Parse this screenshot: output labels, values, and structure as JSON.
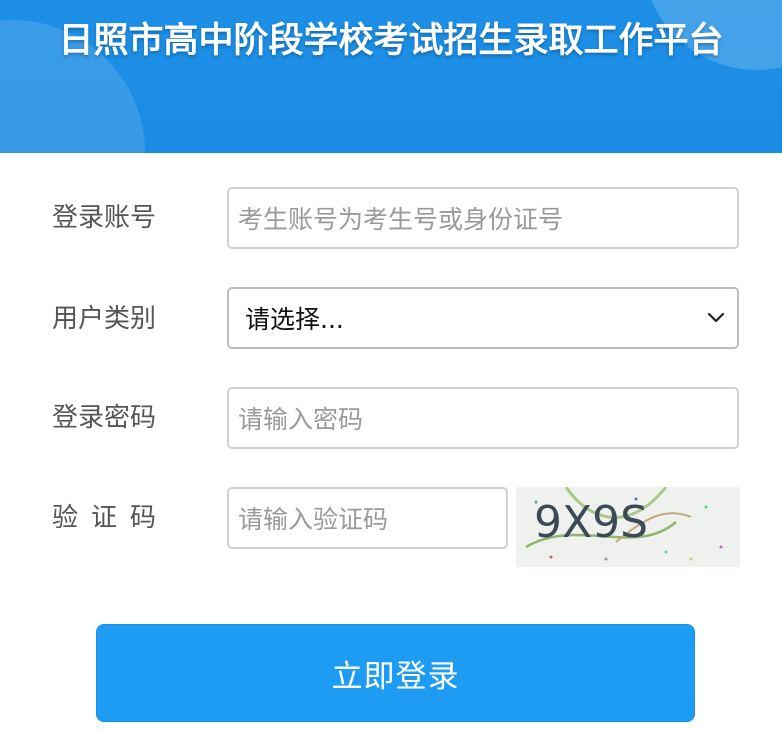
{
  "header": {
    "title": "日照市高中阶段学校考试招生录取工作平台"
  },
  "form": {
    "account": {
      "label": "登录账号",
      "placeholder": "考生账号为考生号或身份证号"
    },
    "user_type": {
      "label": "用户类别",
      "selected": "请选择..."
    },
    "password": {
      "label": "登录密码",
      "placeholder": "请输入密码"
    },
    "captcha": {
      "label": "验证码",
      "placeholder": "请输入验证码",
      "image_text": "9X9S"
    }
  },
  "login_button": {
    "label": "立即登录"
  },
  "colors": {
    "header_blue": "#1d8fe6",
    "button_blue": "#1e9bf2",
    "label_gray": "#555555",
    "placeholder_gray": "#9a9a9a"
  }
}
